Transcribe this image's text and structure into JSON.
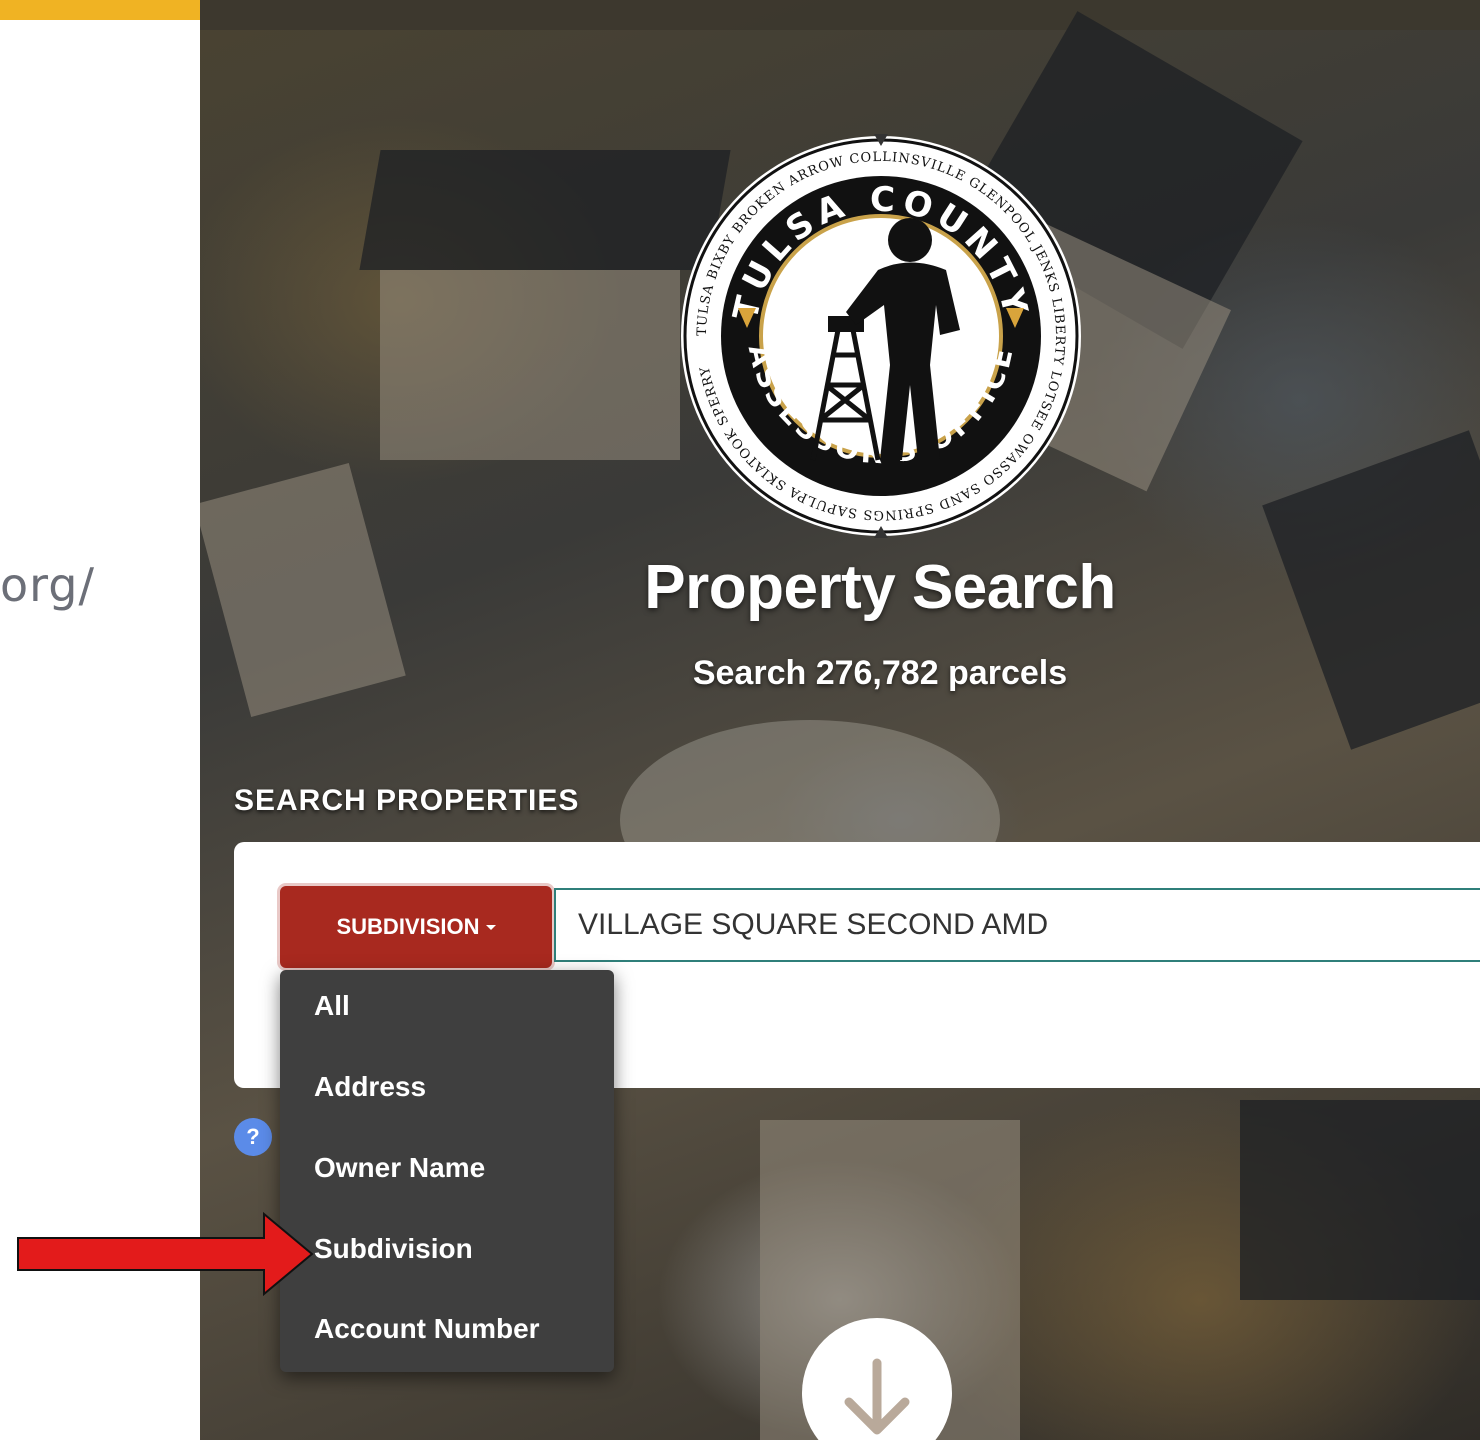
{
  "left_panel": {
    "url_fragment": "org/"
  },
  "hero": {
    "title": "Property Search",
    "subtitle": "Search 276,782 parcels",
    "logo": {
      "center_top": "TULSA COUNTY",
      "center_bottom": "ASSESSOR'S OFFICE",
      "ring_text": "TULSA BIXBY BROKEN ARROW COLLINSVILLE GLENPOOL JENKS LIBERTY LOTSEE OWASSO SAND SPRINGS SAPULPA SKIATOOK SPERRY"
    }
  },
  "search": {
    "heading": "SEARCH PROPERTIES",
    "type_button_label": "SUBDIVISION",
    "input_value": "VILLAGE SQUARE SECOND AMD",
    "help_icon_label": "?"
  },
  "dropdown": {
    "items": [
      "All",
      "Address",
      "Owner Name",
      "Subdivision",
      "Account Number"
    ]
  },
  "colors": {
    "accent_red": "#a8291f",
    "dropdown_bg": "#3f3f3f",
    "input_border": "#2f7f7a",
    "top_bar_yellow": "#f0b323",
    "annotation_arrow": "#e31b1b"
  },
  "icons": {
    "scroll_down": "arrow-down-icon",
    "help": "question-icon",
    "annotation": "red-arrow-icon"
  }
}
